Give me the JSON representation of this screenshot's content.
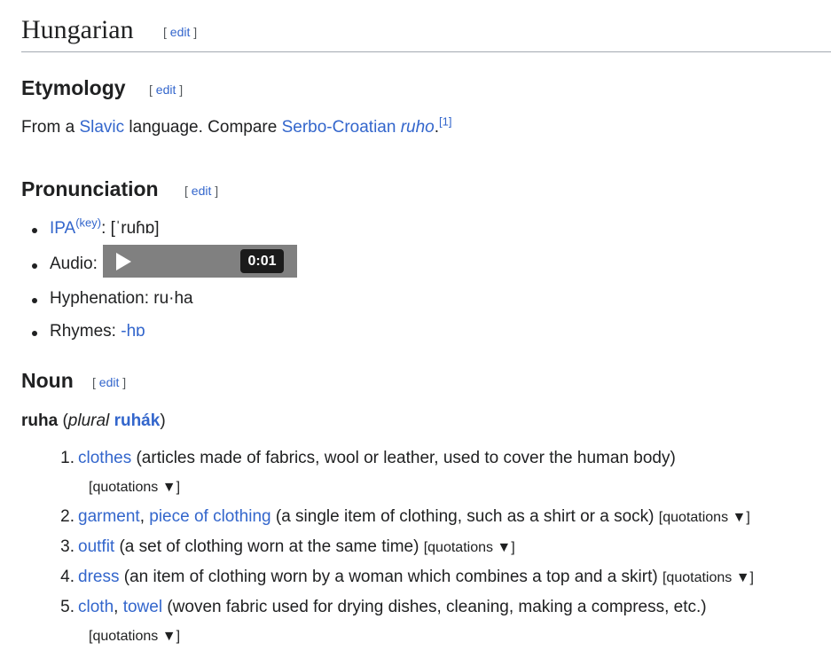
{
  "heading": {
    "title": "Hungarian",
    "edit": "edit"
  },
  "etymology": {
    "title": "Etymology",
    "edit": "edit",
    "prefix": "From a ",
    "slavic_link": "Slavic",
    "middle": " language. Compare ",
    "sc_link": "Serbo-Croatian",
    "space": " ",
    "ruho": "ruho",
    "period": ".",
    "ref": "[1]"
  },
  "pronunciation": {
    "title": "Pronunciation",
    "edit": "edit",
    "ipa_label": "IPA",
    "ipa_key": "(key)",
    "ipa_colon": ": ",
    "ipa_value": "[ˈruɦɒ]",
    "audio_label": "Audio:",
    "audio_time": "0:01",
    "hyphenation": "Hyphenation: ru·ha",
    "rhymes_label": "Rhymes: ",
    "rhymes_value": "-hɒ"
  },
  "noun": {
    "title": "Noun",
    "edit": "edit",
    "headword": "ruha",
    "open_paren": " (",
    "plural_label": "plural",
    "plural_space": " ",
    "plural_form": "ruhák",
    "close_paren": ")",
    "quotations_label": "[quotations ▼]",
    "senses": [
      {
        "num": "1.",
        "links": [
          "clothes"
        ],
        "gloss": " (articles made of fabrics, wool or leather, used to cover the human body)"
      },
      {
        "num": "2.",
        "links": [
          "garment",
          "piece of clothing"
        ],
        "gloss": " (a single item of clothing, such as a shirt or a sock)"
      },
      {
        "num": "3.",
        "links": [
          "outfit"
        ],
        "gloss": " (a set of clothing worn at the same time)"
      },
      {
        "num": "4.",
        "links": [
          "dress"
        ],
        "gloss": " (an item of clothing worn by a woman which combines a top and a skirt)"
      },
      {
        "num": "5.",
        "links": [
          "cloth",
          "towel"
        ],
        "gloss": " (woven fabric used for drying dishes, cleaning, making a compress, etc.)"
      }
    ],
    "comma": ", "
  }
}
